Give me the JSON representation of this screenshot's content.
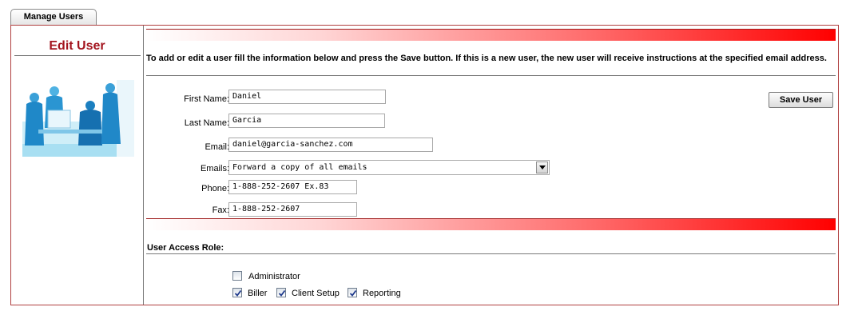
{
  "tab": {
    "label": "Manage Users"
  },
  "sidebar": {
    "title": "Edit User"
  },
  "instructions": "To add or edit a user fill the information below and press the Save button. If this is a new user, the new user will receive instructions at the specified email address.",
  "form": {
    "first_name": {
      "label": "First Name:",
      "value": "Daniel"
    },
    "last_name": {
      "label": "Last Name:",
      "value": "Garcia"
    },
    "email": {
      "label": "Email:",
      "value": "daniel@garcia-sanchez.com"
    },
    "emails": {
      "label": "Emails:",
      "value": "Forward a copy of all emails"
    },
    "phone": {
      "label": "Phone:",
      "value": "1-888-252-2607 Ex.83"
    },
    "fax": {
      "label": "Fax:",
      "value": "1-888-252-2607"
    }
  },
  "save_button": "Save User",
  "access": {
    "title": "User Access Role:",
    "roles": [
      {
        "label": "Administrator",
        "checked": false
      },
      {
        "label": "Biller",
        "checked": true
      },
      {
        "label": "Client Setup",
        "checked": true
      },
      {
        "label": "Reporting",
        "checked": true
      }
    ]
  },
  "colors": {
    "accent_red": "#a3141e",
    "bar_red": "#ff0000",
    "border": "#b04040",
    "illustration_blue": "#3aa0d8"
  }
}
